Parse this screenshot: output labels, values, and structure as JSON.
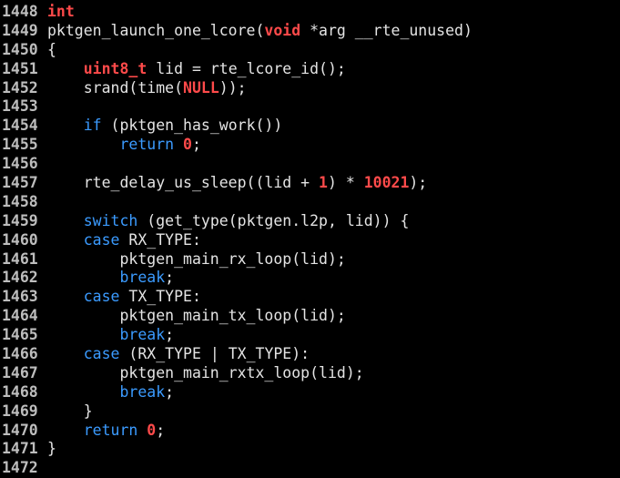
{
  "theme": {
    "background": "#000000",
    "text": "#e4e4e4",
    "line_number": "#bdbdbd",
    "type": "#ff4a4a",
    "keyword": "#3b9bff",
    "number": "#ff4a4a"
  },
  "lines": [
    {
      "n": "1448",
      "tokens": [
        {
          "t": "int",
          "k": "type"
        }
      ]
    },
    {
      "n": "1449",
      "tokens": [
        {
          "t": "pktgen_launch_one_lcore(",
          "k": "plain"
        },
        {
          "t": "void",
          "k": "type"
        },
        {
          "t": " *arg __rte_unused)",
          "k": "plain"
        }
      ]
    },
    {
      "n": "1450",
      "tokens": [
        {
          "t": "{",
          "k": "plain"
        }
      ]
    },
    {
      "n": "1451",
      "tokens": [
        {
          "t": "    ",
          "k": "plain"
        },
        {
          "t": "uint8_t",
          "k": "type"
        },
        {
          "t": " lid = rte_lcore_id();",
          "k": "plain"
        }
      ]
    },
    {
      "n": "1452",
      "tokens": [
        {
          "t": "    srand(time(",
          "k": "plain"
        },
        {
          "t": "NULL",
          "k": "constant"
        },
        {
          "t": "));",
          "k": "plain"
        }
      ]
    },
    {
      "n": "1453",
      "tokens": []
    },
    {
      "n": "1454",
      "tokens": [
        {
          "t": "    ",
          "k": "plain"
        },
        {
          "t": "if",
          "k": "keyword"
        },
        {
          "t": " (pktgen_has_work())",
          "k": "plain"
        }
      ]
    },
    {
      "n": "1455",
      "tokens": [
        {
          "t": "        ",
          "k": "plain"
        },
        {
          "t": "return",
          "k": "keyword"
        },
        {
          "t": " ",
          "k": "plain"
        },
        {
          "t": "0",
          "k": "number"
        },
        {
          "t": ";",
          "k": "plain"
        }
      ]
    },
    {
      "n": "1456",
      "tokens": []
    },
    {
      "n": "1457",
      "tokens": [
        {
          "t": "    rte_delay_us_sleep((lid + ",
          "k": "plain"
        },
        {
          "t": "1",
          "k": "number"
        },
        {
          "t": ") * ",
          "k": "plain"
        },
        {
          "t": "10021",
          "k": "number"
        },
        {
          "t": ");",
          "k": "plain"
        }
      ]
    },
    {
      "n": "1458",
      "tokens": []
    },
    {
      "n": "1459",
      "tokens": [
        {
          "t": "    ",
          "k": "plain"
        },
        {
          "t": "switch",
          "k": "keyword"
        },
        {
          "t": " (get_type(pktgen.l2p, lid)) {",
          "k": "plain"
        }
      ]
    },
    {
      "n": "1460",
      "tokens": [
        {
          "t": "    ",
          "k": "plain"
        },
        {
          "t": "case",
          "k": "keyword"
        },
        {
          "t": " RX_TYPE:",
          "k": "plain"
        }
      ]
    },
    {
      "n": "1461",
      "tokens": [
        {
          "t": "        pktgen_main_rx_loop(lid);",
          "k": "plain"
        }
      ]
    },
    {
      "n": "1462",
      "tokens": [
        {
          "t": "        ",
          "k": "plain"
        },
        {
          "t": "break",
          "k": "keyword"
        },
        {
          "t": ";",
          "k": "plain"
        }
      ]
    },
    {
      "n": "1463",
      "tokens": [
        {
          "t": "    ",
          "k": "plain"
        },
        {
          "t": "case",
          "k": "keyword"
        },
        {
          "t": " TX_TYPE:",
          "k": "plain"
        }
      ]
    },
    {
      "n": "1464",
      "tokens": [
        {
          "t": "        pktgen_main_tx_loop(lid);",
          "k": "plain"
        }
      ]
    },
    {
      "n": "1465",
      "tokens": [
        {
          "t": "        ",
          "k": "plain"
        },
        {
          "t": "break",
          "k": "keyword"
        },
        {
          "t": ";",
          "k": "plain"
        }
      ]
    },
    {
      "n": "1466",
      "tokens": [
        {
          "t": "    ",
          "k": "plain"
        },
        {
          "t": "case",
          "k": "keyword"
        },
        {
          "t": " (RX_TYPE | TX_TYPE):",
          "k": "plain"
        }
      ]
    },
    {
      "n": "1467",
      "tokens": [
        {
          "t": "        pktgen_main_rxtx_loop(lid);",
          "k": "plain"
        }
      ]
    },
    {
      "n": "1468",
      "tokens": [
        {
          "t": "        ",
          "k": "plain"
        },
        {
          "t": "break",
          "k": "keyword"
        },
        {
          "t": ";",
          "k": "plain"
        }
      ]
    },
    {
      "n": "1469",
      "tokens": [
        {
          "t": "    }",
          "k": "plain"
        }
      ]
    },
    {
      "n": "1470",
      "tokens": [
        {
          "t": "    ",
          "k": "plain"
        },
        {
          "t": "return",
          "k": "keyword"
        },
        {
          "t": " ",
          "k": "plain"
        },
        {
          "t": "0",
          "k": "number"
        },
        {
          "t": ";",
          "k": "plain"
        }
      ]
    },
    {
      "n": "1471",
      "tokens": [
        {
          "t": "}",
          "k": "plain"
        }
      ]
    },
    {
      "n": "1472",
      "tokens": []
    }
  ]
}
